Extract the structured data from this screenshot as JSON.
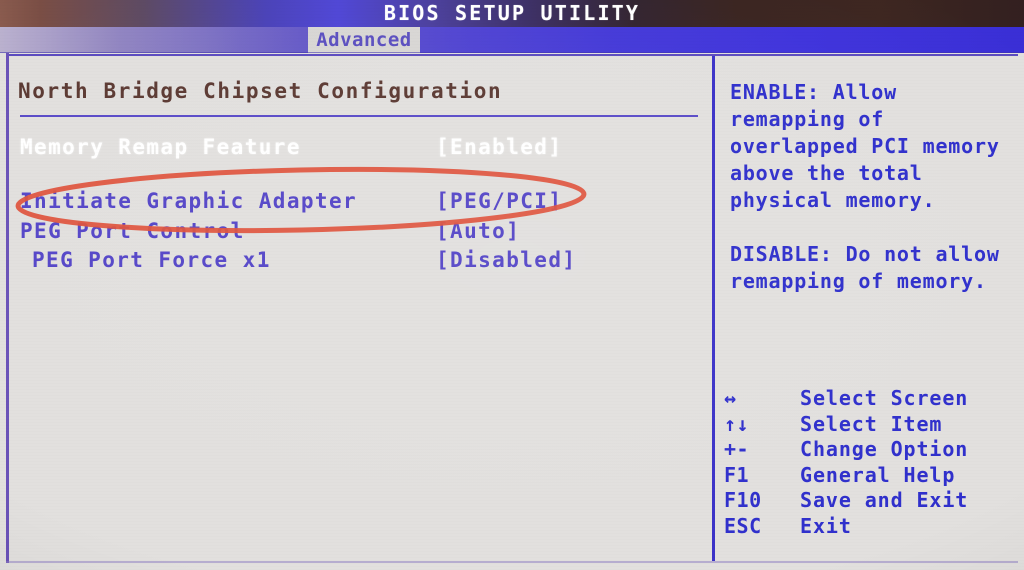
{
  "titlebar": {
    "title": "BIOS SETUP UTILITY"
  },
  "menubar": {
    "active_tab": "Advanced"
  },
  "main": {
    "section_heading": "North Bridge Chipset Configuration",
    "options": [
      {
        "label": "Memory Remap Feature",
        "value": "[Enabled]"
      },
      {
        "label": "Initiate Graphic Adapter",
        "value": "[PEG/PCI]"
      },
      {
        "label": "PEG Port Control",
        "value": "[Auto]"
      },
      {
        "label": "PEG Port Force x1",
        "value": "[Disabled]"
      }
    ]
  },
  "help": {
    "enable_text": "ENABLE: Allow\nremapping of\noverlapped PCI memory\nabove the total\nphysical memory.",
    "disable_text": "DISABLE: Do not allow\nremapping of memory."
  },
  "key_legend": [
    {
      "symbol": "↔",
      "desc": "Select Screen"
    },
    {
      "symbol": "↑↓",
      "desc": "Select Item"
    },
    {
      "symbol": "+-",
      "desc": "Change Option"
    },
    {
      "symbol": "F1",
      "desc": "General Help"
    },
    {
      "symbol": "F10",
      "desc": "Save and Exit"
    },
    {
      "symbol": "ESC",
      "desc": "Exit"
    }
  ],
  "colors": {
    "background": "#e2e0de",
    "heading_text": "#5c3a33",
    "option_text": "#5546c8",
    "selected_text": "#ffffff",
    "help_text": "#2f2fcc",
    "divider": "#3b32c8",
    "annotation": "#e0533c",
    "tab_background": "#d8d6d4",
    "tab_text": "#5b4fc0"
  },
  "annotation": {
    "shape": "ellipse",
    "target": "Memory Remap Feature [Enabled]"
  }
}
